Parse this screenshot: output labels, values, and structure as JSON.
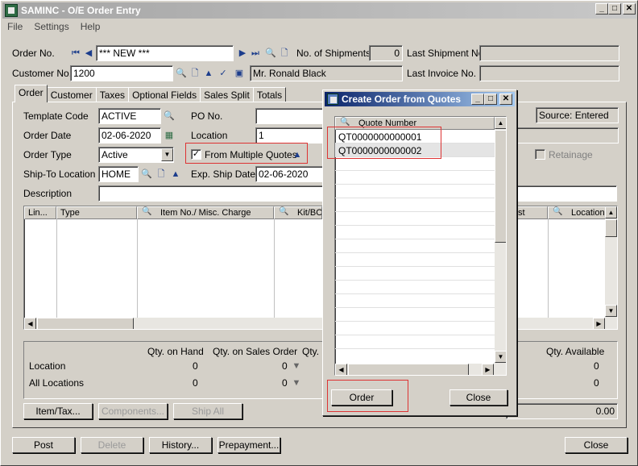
{
  "window": {
    "title": "SAMINC - O/E Order Entry"
  },
  "menu": [
    "File",
    "Settings",
    "Help"
  ],
  "header": {
    "order_no_label": "Order No.",
    "order_no_value": "*** NEW ***",
    "num_shipments_label": "No. of Shipments",
    "num_shipments_value": "0",
    "last_shipment_label": "Last Shipment No.",
    "last_shipment_value": "",
    "customer_no_label": "Customer No.",
    "customer_no_value": "1200",
    "customer_name": "Mr. Ronald Black",
    "last_invoice_label": "Last Invoice No.",
    "last_invoice_value": ""
  },
  "tabs": [
    "Order",
    "Customer",
    "Taxes",
    "Optional Fields",
    "Sales Split",
    "Totals"
  ],
  "order_tab": {
    "template_code_label": "Template Code",
    "template_code_value": "ACTIVE",
    "po_no_label": "PO No.",
    "po_no_value": "",
    "source_text": "Source: Entered",
    "order_date_label": "Order Date",
    "order_date_value": "02-06-2020",
    "location_label": "Location",
    "location_value": "1",
    "order_type_label": "Order Type",
    "order_type_value": "Active",
    "from_multiple_quotes_label": "From Multiple Quotes",
    "from_multiple_quotes_checked": "✓",
    "retainage_label": "Retainage",
    "ship_to_label": "Ship-To Location",
    "ship_to_value": "HOME",
    "exp_ship_date_label": "Exp. Ship Date",
    "exp_ship_date_value": "02-06-2020",
    "description_label": "Description",
    "description_value": ""
  },
  "detail_grid": {
    "columns": [
      "Lin...",
      "Type",
      "Item No./ Misc. Charge",
      "Kit/BO",
      "st",
      "Location"
    ]
  },
  "qty_panel": {
    "headers": [
      "Qty. on Hand",
      "Qty. on Sales Order",
      "Qty. o",
      "Qty. Available"
    ],
    "rows": [
      {
        "label": "Location",
        "on_hand": "0",
        "on_sales_order": "0",
        "available": "0"
      },
      {
        "label": "All Locations",
        "on_hand": "0",
        "on_sales_order": "0",
        "available": "0"
      }
    ],
    "total_value": "0.00"
  },
  "panel_buttons": {
    "item_tax": "Item/Tax...",
    "components": "Components...",
    "ship_all": "Ship All"
  },
  "bottom_buttons": {
    "post": "Post",
    "delete": "Delete",
    "history": "History...",
    "prepayment": "Prepayment...",
    "close": "Close"
  },
  "dialog": {
    "title": "Create Order from Quotes",
    "column_header": "Quote Number",
    "quotes": [
      "QT0000000000001",
      "QT0000000000002"
    ],
    "order_button": "Order",
    "close_button": "Close"
  },
  "colors": {
    "dialog_title": "#0a246a",
    "highlight": "#dd3333"
  }
}
